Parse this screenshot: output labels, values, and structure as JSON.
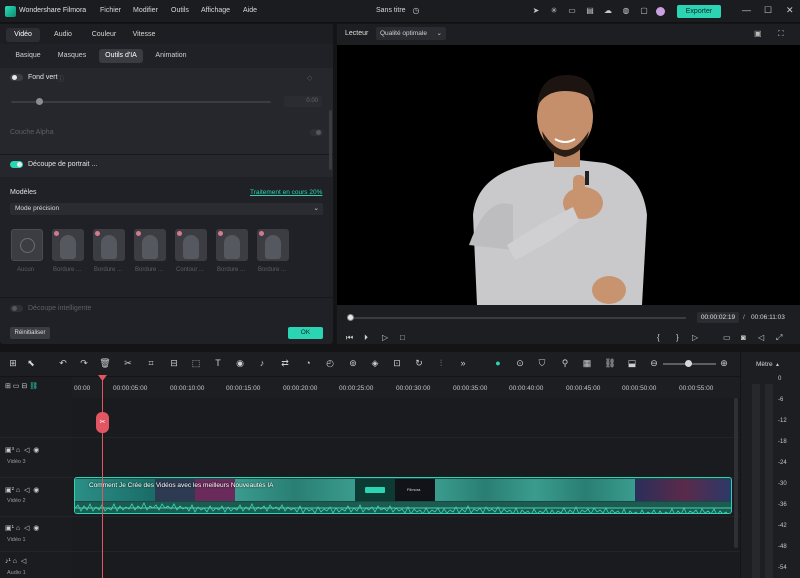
{
  "app": {
    "name": "Wondershare Filmora",
    "document_title": "Sans titre",
    "export_label": "Exporter",
    "accent": "#2bd5b3",
    "playhead_color": "#e25563"
  },
  "menu": [
    "Fichier",
    "Modifier",
    "Outils",
    "Affichage",
    "Aide"
  ],
  "left_panel": {
    "tabs": [
      "Vidéo",
      "Audio",
      "Couleur",
      "Vitesse"
    ],
    "active_tab": "Vidéo",
    "subtabs": [
      "Basique",
      "Masques",
      "Outils d'IA",
      "Animation"
    ],
    "active_subtab": "Outils d'IA",
    "fond_vert": {
      "label": "Fond vert",
      "enabled": false,
      "value": "0.00"
    },
    "couche_alpha": {
      "label": "Couche Alpha",
      "enabled": false
    },
    "decoupe_portrait": {
      "label": "Découpe de portrait ...",
      "enabled": true
    },
    "modeles": {
      "label": "Modèles",
      "progress_text": "Traitement en cours 20%",
      "progress": 0.2,
      "mode": "Mode précision"
    },
    "presets": [
      "Aucun",
      "Bordure ...",
      "Bordure ...",
      "Bordure ...",
      "Contour ...",
      "Bordure ...",
      "Bordure ..."
    ],
    "decoupe_intelligente": {
      "label": "Découpe intelligente"
    },
    "reset_label": "Réinitialiser",
    "ok_label": "OK"
  },
  "player": {
    "label": "Lecteur",
    "quality": "Qualité optimale",
    "current_time": "00:00:02:19",
    "total_time": "00:06:11:03",
    "progress": 0.005
  },
  "timeline": {
    "ruler": [
      "00:00",
      "00:00:05:00",
      "00:00:10:00",
      "00:00:15:00",
      "00:00:20:00",
      "00:00:25:00",
      "00:00:30:00",
      "00:00:35:00",
      "00:00:40:00",
      "00:00:45:00",
      "00:00:50:00",
      "00:00:55:00"
    ],
    "tracks": [
      {
        "id": "3",
        "name": "Vidéo 3"
      },
      {
        "id": "2",
        "name": "Vidéo 2"
      },
      {
        "id": "1",
        "name": "Vidéo 1"
      },
      {
        "id": "1",
        "name": "Audio 1"
      }
    ],
    "clip_title": "Comment Je Crée des Vidéos avec les meilleurs Nouveautés IA",
    "marker_chip": "Filmora"
  },
  "meter": {
    "title": "Mètre",
    "labels": [
      "0",
      "-6",
      "-12",
      "-18",
      "-24",
      "-30",
      "-36",
      "-42",
      "-48",
      "-54"
    ]
  }
}
